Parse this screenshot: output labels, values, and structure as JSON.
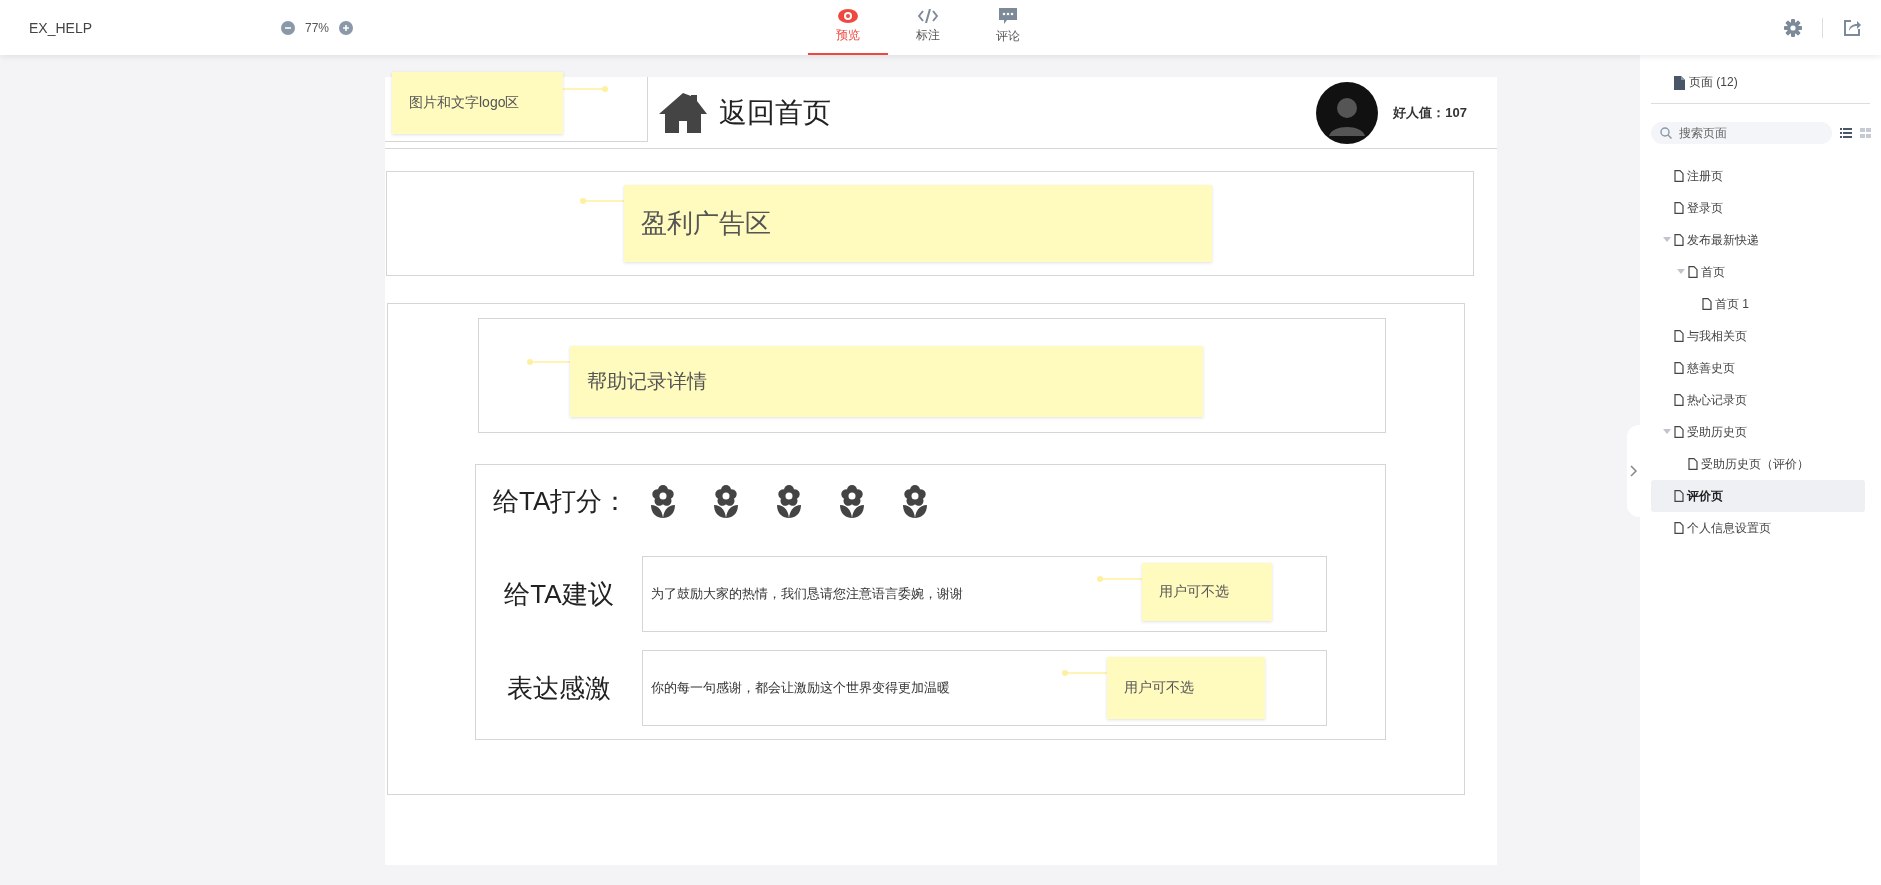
{
  "toolbar": {
    "project": "EX_HELP",
    "zoom": "77%",
    "tabs": [
      {
        "label": "预览",
        "selected": true
      },
      {
        "label": "标注",
        "selected": false
      },
      {
        "label": "评论",
        "selected": false
      }
    ]
  },
  "canvas": {
    "logo_note": "图片和文字logo区",
    "home_link": "返回首页",
    "score": "好人值：107",
    "ad_note": "盈利广告区",
    "detail_note": "帮助记录详情",
    "rating": {
      "label": "给TA打分：",
      "stars": 5
    },
    "fields": [
      {
        "label": "给TA建议",
        "placeholder": "为了鼓励大家的热情，我们恳请您注意语言委婉，谢谢",
        "note": "用户可不选"
      },
      {
        "label": "表达感激",
        "placeholder": "你的每一句感谢，都会让激励这个世界变得更加温暖",
        "note": "用户可不选"
      }
    ]
  },
  "sidebar": {
    "title": "页面 (12)",
    "search": {
      "placeholder": "搜索页面"
    },
    "pages": [
      {
        "label": "注册页",
        "selected": false
      },
      {
        "label": "登录页",
        "selected": false
      },
      {
        "label": "发布最新快递",
        "selected": false,
        "expanded": true,
        "children": [
          {
            "label": "首页",
            "selected": false,
            "expanded": true,
            "children": [
              {
                "label": "首页 1",
                "selected": false
              }
            ]
          }
        ]
      },
      {
        "label": "与我相关页",
        "selected": false
      },
      {
        "label": "慈善史页",
        "selected": false
      },
      {
        "label": "热心记录页",
        "selected": false
      },
      {
        "label": "受助历史页",
        "selected": false,
        "expanded": true,
        "children": [
          {
            "label": "受助历史页（评价）",
            "selected": false
          }
        ]
      },
      {
        "label": "评价页",
        "selected": true
      },
      {
        "label": "个人信息设置页",
        "selected": false
      }
    ]
  }
}
